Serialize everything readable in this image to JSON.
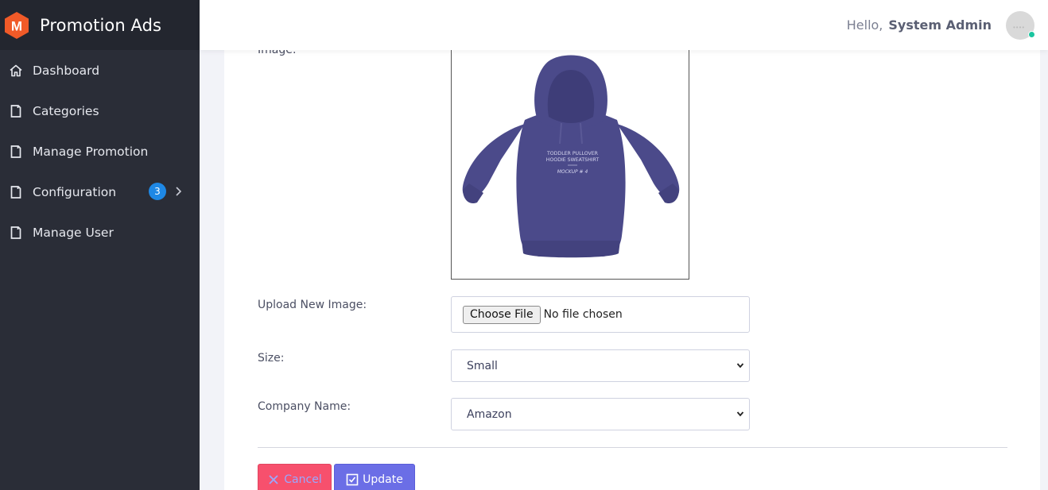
{
  "app": {
    "title": "Promotion Ads",
    "logo_letter": "M",
    "brand_color": "#f05a28"
  },
  "sidebar": {
    "items": [
      {
        "label": "Dashboard",
        "icon": "home-icon"
      },
      {
        "label": "Categories",
        "icon": "page-icon"
      },
      {
        "label": "Manage Promotion",
        "icon": "page-icon"
      },
      {
        "label": "Configuration",
        "icon": "page-icon",
        "badge": "3",
        "chevron": "chevron-right-icon"
      },
      {
        "label": "Manage User",
        "icon": "page-icon"
      }
    ]
  },
  "header": {
    "greeting": "Hello,",
    "username": "System Admin",
    "status_color": "#1bc5a0"
  },
  "form": {
    "image_label": "Image:",
    "hoodie_text_line1": "TODDLER PULLOVER",
    "hoodie_text_line2": "HOODIE SWEATSHIRT",
    "hoodie_text_line3": "MOCKUP # 4",
    "upload_label": "Upload New Image:",
    "file_button": "Choose File",
    "file_status": "No file chosen",
    "size_label": "Size:",
    "size_value": "Small",
    "company_label": "Company Name:",
    "company_value": "Amazon",
    "cancel_label": "Cancel",
    "update_label": "Update"
  },
  "colors": {
    "sidebar_bg": "#2a2d37",
    "accent": "#6b6ee6",
    "danger": "#f7506d",
    "badge": "#1e88e5",
    "hoodie": "#4b4a8a"
  }
}
